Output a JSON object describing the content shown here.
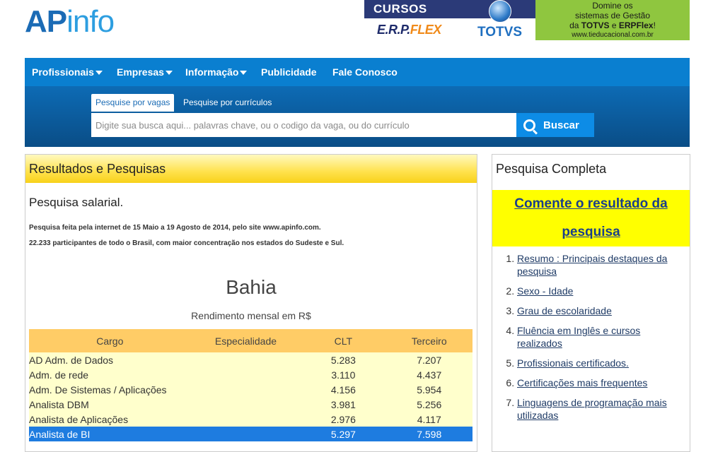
{
  "logo": {
    "part1": "AP",
    "part2": "info"
  },
  "banner_ad1": {
    "top": "CURSOS",
    "brand1a": "E.R.P.",
    "brand1b": "FLEX",
    "brand2": "TOTVS"
  },
  "banner_ad2": {
    "line1": "Domine os",
    "line2": "sistemas de Gestão",
    "line3_a": "da ",
    "line3_b": "TOTVS",
    "line3_c": " e ",
    "line3_d": "ERPFlex",
    "line3_e": "!",
    "site": "www.tieducacional.com.br"
  },
  "nav": {
    "items": [
      {
        "label": "Profissionais",
        "dropdown": true
      },
      {
        "label": "Empresas",
        "dropdown": true
      },
      {
        "label": "Informação",
        "dropdown": true
      },
      {
        "label": "Publicidade",
        "dropdown": false
      },
      {
        "label": "Fale Conosco",
        "dropdown": false
      }
    ]
  },
  "search": {
    "tab_active": "Pesquise por vagas",
    "tab_inactive": "Pesquise por currículos",
    "placeholder": "Digite sua busca aqui... palavras chave, ou o codigo da vaga, ou do currículo",
    "button_label": "Buscar"
  },
  "results": {
    "title": "Resultados e Pesquisas",
    "survey_title": "Pesquisa salarial.",
    "note1": "Pesquisa feita pela internet de 15 Maio a 19 Agosto de 2014, pelo site www.apinfo.com.",
    "note2": "22.233 participantes de todo o Brasil, com maior concentração nos estados do Sudeste e Sul.",
    "region": "Bahia",
    "region_sub": "Rendimento mensal em R$",
    "columns": [
      "Cargo",
      "Especialidade",
      "CLT",
      "Terceiro"
    ],
    "rows": [
      {
        "cargo": "AD Adm. de Dados",
        "esp": "",
        "clt": "5.283",
        "ter": "7.207"
      },
      {
        "cargo": "Adm. de rede",
        "esp": "",
        "clt": "3.110",
        "ter": "4.437"
      },
      {
        "cargo": "Adm. De Sistemas / Aplicações",
        "esp": "",
        "clt": "4.156",
        "ter": "5.954"
      },
      {
        "cargo": "Analista DBM",
        "esp": "",
        "clt": "3.981",
        "ter": "5.256"
      },
      {
        "cargo": "Analista de Aplicações",
        "esp": "",
        "clt": "2.976",
        "ter": "4.117"
      },
      {
        "cargo": "Analista de BI",
        "esp": "",
        "clt": "5.297",
        "ter": "7.598"
      }
    ]
  },
  "sidebar": {
    "title": "Pesquisa Completa",
    "comment_link_1": "Comente o resultado da",
    "comment_link_2": "pesquisa",
    "toc": [
      " Resumo : Principais destaques da pesquisa",
      "Sexo - Idade",
      "Grau de escolaridade",
      "Fluência em Inglês e cursos realizados",
      "Profissionais certificados.",
      "Certificações mais frequentes",
      "Linguagens de programação mais utilizadas"
    ]
  }
}
